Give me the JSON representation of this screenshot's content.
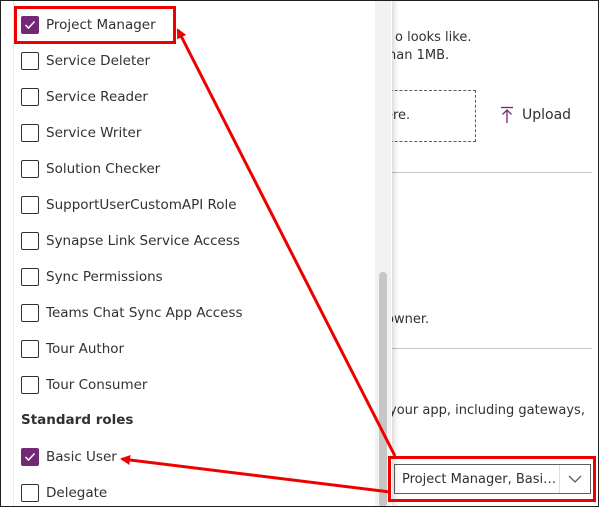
{
  "background": {
    "line1": "o looks like.",
    "line2": "han 1MB.",
    "dropzone_text": "ere.",
    "upload_label": "Upload",
    "owner_text": "owner.",
    "gateways_text": "your app, including gateways,"
  },
  "dropdown": {
    "custom_roles": [
      {
        "label": "Project Manager",
        "checked": true
      },
      {
        "label": "Service Deleter",
        "checked": false
      },
      {
        "label": "Service Reader",
        "checked": false
      },
      {
        "label": "Service Writer",
        "checked": false
      },
      {
        "label": "Solution Checker",
        "checked": false
      },
      {
        "label": "SupportUserCustomAPI Role",
        "checked": false
      },
      {
        "label": "Synapse Link Service Access",
        "checked": false
      },
      {
        "label": "Sync Permissions",
        "checked": false
      },
      {
        "label": "Teams Chat Sync App Access",
        "checked": false
      },
      {
        "label": "Tour Author",
        "checked": false
      },
      {
        "label": "Tour Consumer",
        "checked": false
      }
    ],
    "standard_roles_header": "Standard roles",
    "standard_roles": [
      {
        "label": "Basic User",
        "checked": true
      },
      {
        "label": "Delegate",
        "checked": false
      }
    ]
  },
  "combo": {
    "value": "Project Manager, Basic ..."
  },
  "colors": {
    "accent": "#742774",
    "annotation": "#ee0000"
  },
  "icons": {
    "checkmark": "checkmark-icon",
    "upload": "upload-icon",
    "chevron": "chevron-down-icon"
  }
}
